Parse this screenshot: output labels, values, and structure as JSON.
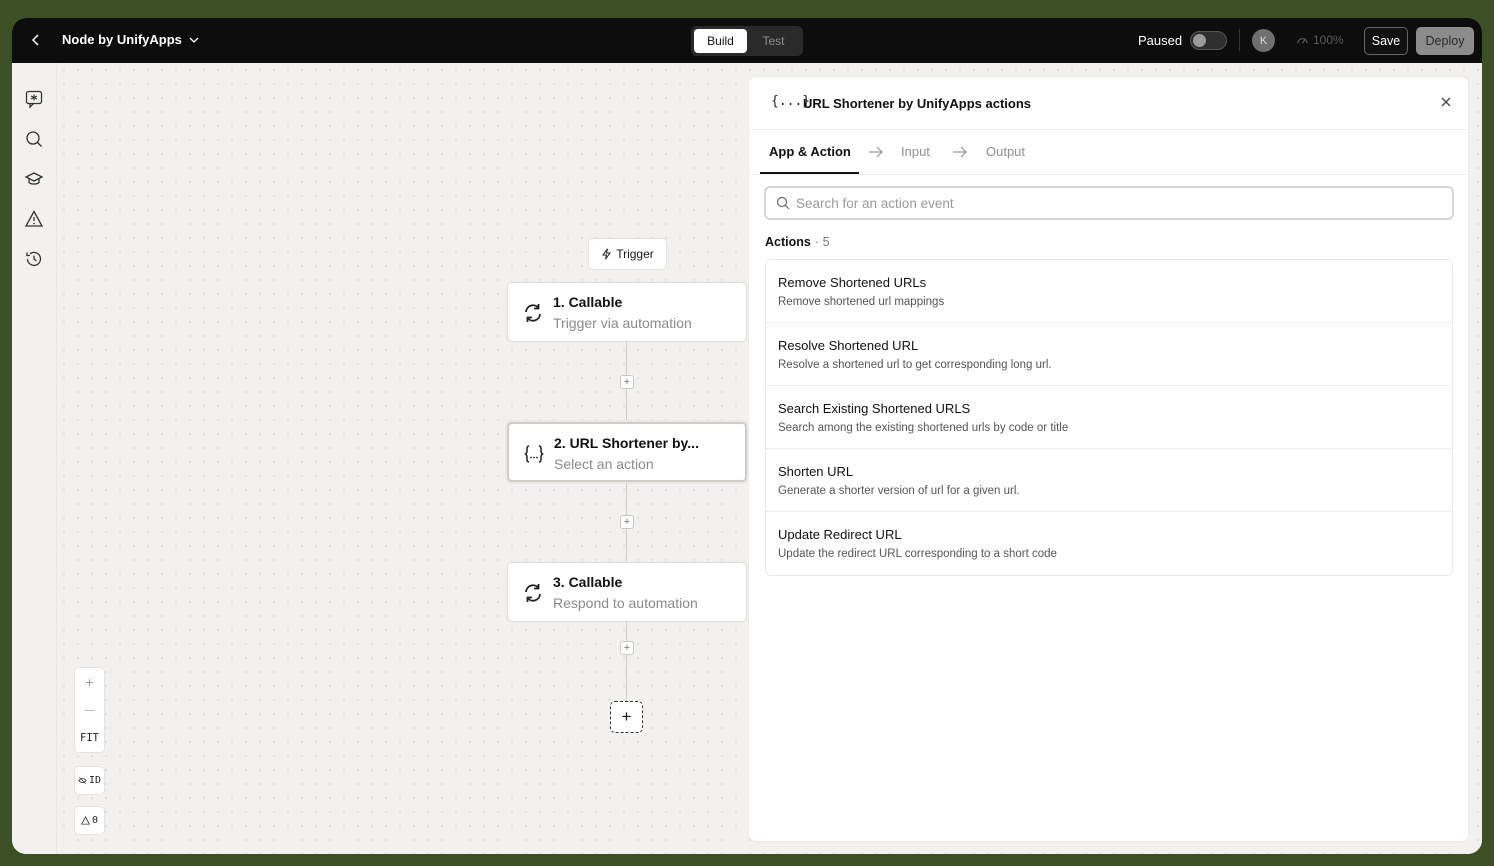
{
  "topbar": {
    "app_name": "Node by UnifyApps",
    "modes": [
      {
        "label": "Build",
        "active": true
      },
      {
        "label": "Test",
        "active": false
      }
    ],
    "paused_label": "Paused",
    "paused_on": false,
    "avatar_initial": "K",
    "progress_label": "100%",
    "save_label": "Save",
    "deploy_label": "Deploy"
  },
  "sidebar": {
    "icons": [
      "sparkle-chat-icon",
      "search-icon",
      "graduation-cap-icon",
      "warning-icon",
      "history-icon"
    ]
  },
  "canvas": {
    "trigger_label": "Trigger",
    "nodes": [
      {
        "title": "1. Callable",
        "subtitle": "Trigger via automation",
        "icon": "refresh-icon"
      },
      {
        "title": "2. URL Shortener by...",
        "subtitle": "Select an action",
        "icon": "braces-icon"
      },
      {
        "title": "3. Callable",
        "subtitle": "Respond to automation",
        "icon": "refresh-icon"
      }
    ],
    "zoom": {
      "in": "+",
      "out": "—",
      "fit": "FIT"
    },
    "id_toggle": "ID",
    "warnings_count": "0"
  },
  "panel": {
    "icon_text": "{...}",
    "title": "URL Shortener by UnifyApps actions",
    "steps": [
      {
        "label": "App & Action",
        "active": true
      },
      {
        "label": "Input",
        "active": false
      },
      {
        "label": "Output",
        "active": false
      }
    ],
    "search_placeholder": "Search for an action event",
    "actions_label": "Actions",
    "actions_count": "5",
    "actions": [
      {
        "title": "Remove Shortened URLs",
        "description": "Remove shortened url mappings"
      },
      {
        "title": "Resolve Shortened URL",
        "description": "Resolve a shortened url to get corresponding long url."
      },
      {
        "title": "Search Existing Shortened URLS",
        "description": "Search among the existing shortened urls by code or title"
      },
      {
        "title": "Shorten URL",
        "description": "Generate a shorter version of url for a given url."
      },
      {
        "title": "Update Redirect URL",
        "description": "Update the redirect URL corresponding to a short code"
      }
    ]
  }
}
